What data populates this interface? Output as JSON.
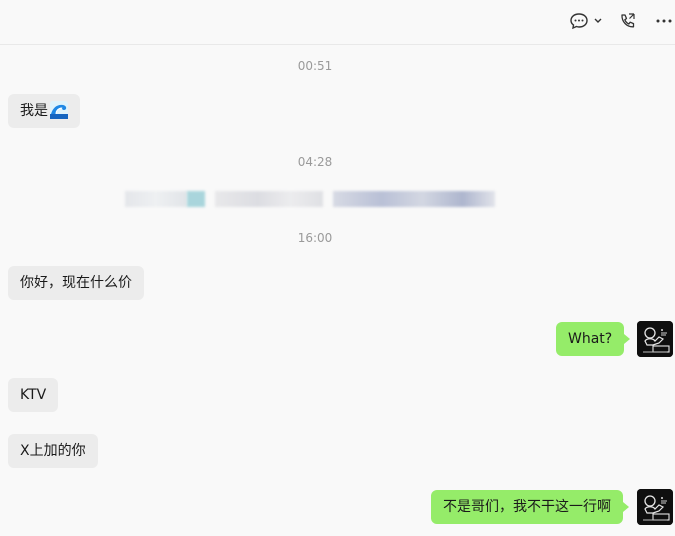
{
  "toolbar": {
    "icons": [
      "chat-bubble-icon",
      "chevron-down-icon",
      "phone-call-icon",
      "more-icon"
    ]
  },
  "messages": {
    "ts1": "00:51",
    "m1_text": "我是",
    "ts2": "04:28",
    "ts3": "16:00",
    "m3_text": "你好，现在什么价",
    "m4_text": "What?",
    "m5_text": "KTV",
    "m6_text": "X上加的你",
    "m7_text": "不是哥们，我不干这一行啊"
  },
  "colors": {
    "incoming_bubble": "#ececec",
    "outgoing_bubble": "#95ec69",
    "background": "#f9f9f9",
    "timestamp": "#9a9a9a"
  }
}
